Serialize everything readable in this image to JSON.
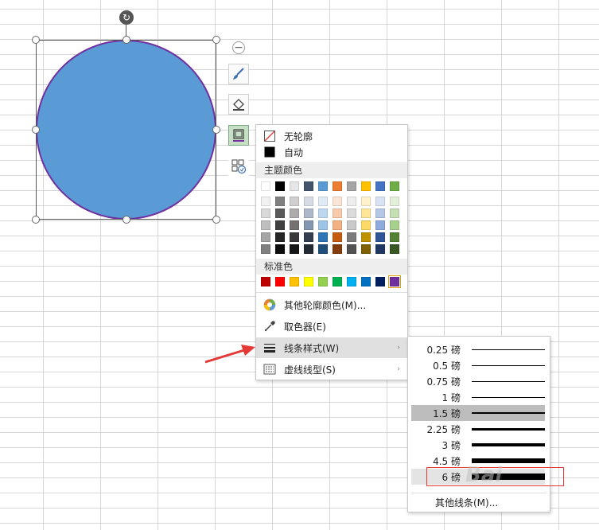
{
  "colors": {
    "circle_fill": "#5b9bd5",
    "circle_outline": "#7030a0",
    "menu_highlight": "#e0e0e0",
    "arrow": "#e53935"
  },
  "toolbar": {
    "minus": "−",
    "icons": [
      "paintbrush-icon",
      "fill-bucket-icon",
      "outline-icon",
      "effects-icon"
    ]
  },
  "menu": {
    "no_outline": "无轮廓",
    "automatic": "自动",
    "theme_colors_label": "主题颜色",
    "standard_colors_label": "标准色",
    "more_colors": "其他轮廓颜色(M)...",
    "eyedropper": "取色器(E)",
    "line_style": "线条样式(W)",
    "dash_type": "虚线线型(S)"
  },
  "theme_colors": [
    [
      "#ffffff",
      "#f2f2f2",
      "#d9d9d9",
      "#bfbfbf",
      "#a6a6a6",
      "#808080"
    ],
    [
      "#000000",
      "#7f7f7f",
      "#595959",
      "#404040",
      "#262626",
      "#0d0d0d"
    ],
    [
      "#e7e6e6",
      "#d0cece",
      "#aeabab",
      "#757171",
      "#3a3838",
      "#171616"
    ],
    [
      "#44546a",
      "#d6dce5",
      "#adb9ca",
      "#8497b0",
      "#333f50",
      "#222a35"
    ],
    [
      "#5b9bd5",
      "#deebf7",
      "#bdd7ee",
      "#9dc3e6",
      "#2e75b6",
      "#1f4e79"
    ],
    [
      "#ed7d31",
      "#fbe5d6",
      "#f8cbad",
      "#f4b183",
      "#c55a11",
      "#843c0c"
    ],
    [
      "#a5a5a5",
      "#ededed",
      "#dbdbdb",
      "#c9c9c9",
      "#7b7b7b",
      "#525252"
    ],
    [
      "#ffc000",
      "#fff2cc",
      "#ffe699",
      "#ffd966",
      "#bf9000",
      "#7f6000"
    ],
    [
      "#4472c4",
      "#dae3f3",
      "#b4c7e7",
      "#8faadc",
      "#2f5597",
      "#203864"
    ],
    [
      "#70ad47",
      "#e2f0d9",
      "#c5e0b4",
      "#a9d18e",
      "#548235",
      "#385723"
    ]
  ],
  "standard_colors": [
    "#c00000",
    "#ff0000",
    "#ffc000",
    "#ffff00",
    "#92d050",
    "#00b050",
    "#00b0f0",
    "#0070c0",
    "#002060",
    "#7030a0"
  ],
  "line_widths": [
    {
      "label": "0.25 磅",
      "weight": 0.25
    },
    {
      "label": "0.5 磅",
      "weight": 0.5
    },
    {
      "label": "0.75 磅",
      "weight": 0.75
    },
    {
      "label": "1 磅",
      "weight": 1
    },
    {
      "label": "1.5 磅",
      "weight": 1.5
    },
    {
      "label": "2.25 磅",
      "weight": 2.25
    },
    {
      "label": "3 磅",
      "weight": 3
    },
    {
      "label": "4.5 磅",
      "weight": 4.5
    },
    {
      "label": "6 磅",
      "weight": 6
    }
  ],
  "more_lines": "其他线条(M)...",
  "watermark": "Bai"
}
